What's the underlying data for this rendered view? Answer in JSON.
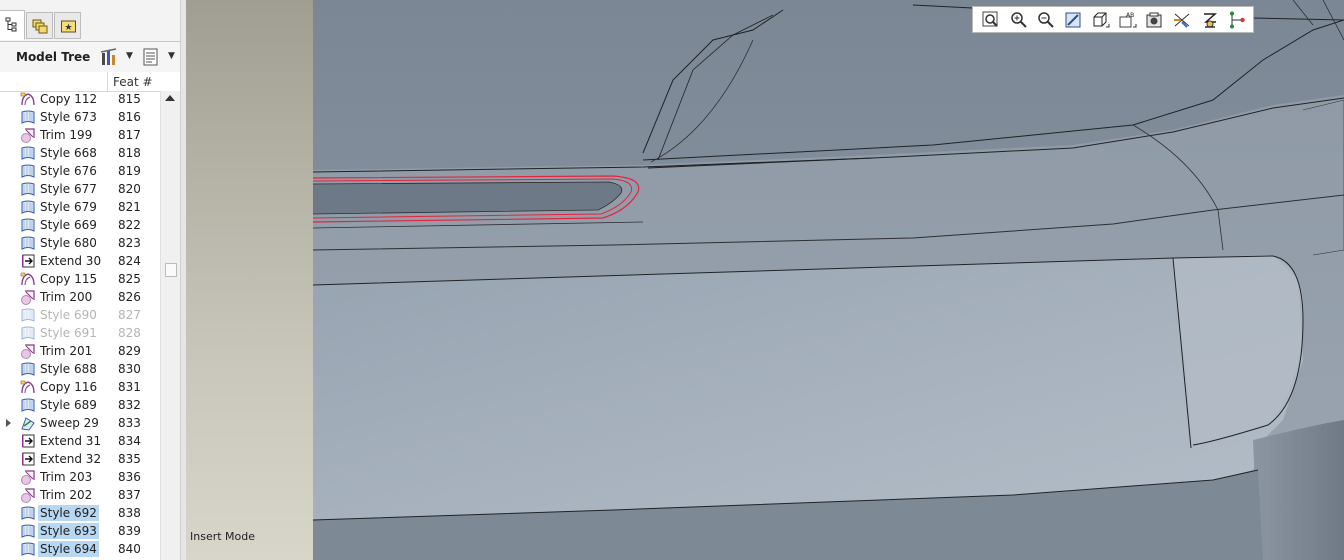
{
  "tabs": [
    {
      "icon": "model-tree-icon",
      "active": true
    },
    {
      "icon": "folder-browser-icon",
      "active": false
    },
    {
      "icon": "favorites-icon",
      "active": false
    }
  ],
  "model_tree": {
    "label": "Model Tree",
    "settings_icon": "tree-settings-icon",
    "columns_icon": "tree-columns-icon",
    "column_header": "Feat #"
  },
  "rows": [
    {
      "name": "Copy 112",
      "num": "815",
      "icon": "copy-icon"
    },
    {
      "name": "Style 673",
      "num": "816",
      "icon": "style-icon"
    },
    {
      "name": "Trim 199",
      "num": "817",
      "icon": "trim-icon"
    },
    {
      "name": "Style 668",
      "num": "818",
      "icon": "style-icon"
    },
    {
      "name": "Style 676",
      "num": "819",
      "icon": "style-icon"
    },
    {
      "name": "Style 677",
      "num": "820",
      "icon": "style-icon"
    },
    {
      "name": "Style 679",
      "num": "821",
      "icon": "style-icon"
    },
    {
      "name": "Style 669",
      "num": "822",
      "icon": "style-icon"
    },
    {
      "name": "Style 680",
      "num": "823",
      "icon": "style-icon"
    },
    {
      "name": "Extend 30",
      "num": "824",
      "icon": "extend-icon"
    },
    {
      "name": "Copy 115",
      "num": "825",
      "icon": "copy-icon"
    },
    {
      "name": "Trim 200",
      "num": "826",
      "icon": "trim-icon"
    },
    {
      "name": "Style 690",
      "num": "827",
      "icon": "style-icon",
      "state": "suppressed"
    },
    {
      "name": "Style 691",
      "num": "828",
      "icon": "style-icon",
      "state": "suppressed"
    },
    {
      "name": "Trim 201",
      "num": "829",
      "icon": "trim-icon"
    },
    {
      "name": "Style 688",
      "num": "830",
      "icon": "style-icon"
    },
    {
      "name": "Copy 116",
      "num": "831",
      "icon": "copy-icon"
    },
    {
      "name": "Style 689",
      "num": "832",
      "icon": "style-icon"
    },
    {
      "name": "Sweep 29",
      "num": "833",
      "icon": "sweep-icon",
      "expandable": true
    },
    {
      "name": "Extend 31",
      "num": "834",
      "icon": "extend-icon"
    },
    {
      "name": "Extend 32",
      "num": "835",
      "icon": "extend-icon"
    },
    {
      "name": "Trim 203",
      "num": "836",
      "icon": "trim-icon"
    },
    {
      "name": "Trim 202",
      "num": "837",
      "icon": "trim-icon"
    },
    {
      "name": "Style 692",
      "num": "838",
      "icon": "style-icon",
      "state": "selected"
    },
    {
      "name": "Style 693",
      "num": "839",
      "icon": "style-icon",
      "state": "selected"
    },
    {
      "name": "Style 694",
      "num": "840",
      "icon": "style-icon",
      "state": "selected"
    }
  ],
  "status_text": "Insert Mode",
  "view_toolbar": [
    "refit-icon",
    "zoom-in-icon",
    "zoom-out-icon",
    "repaint-icon",
    "display-style-icon",
    "saved-views-icon",
    "view-manager-icon",
    "datum-display-icon",
    "spin-center-icon",
    "annotation-display-icon"
  ],
  "colors": {
    "selection": "#b7d7f3",
    "highlight_edge": "#e0263f",
    "surface": "#8a96a4"
  }
}
